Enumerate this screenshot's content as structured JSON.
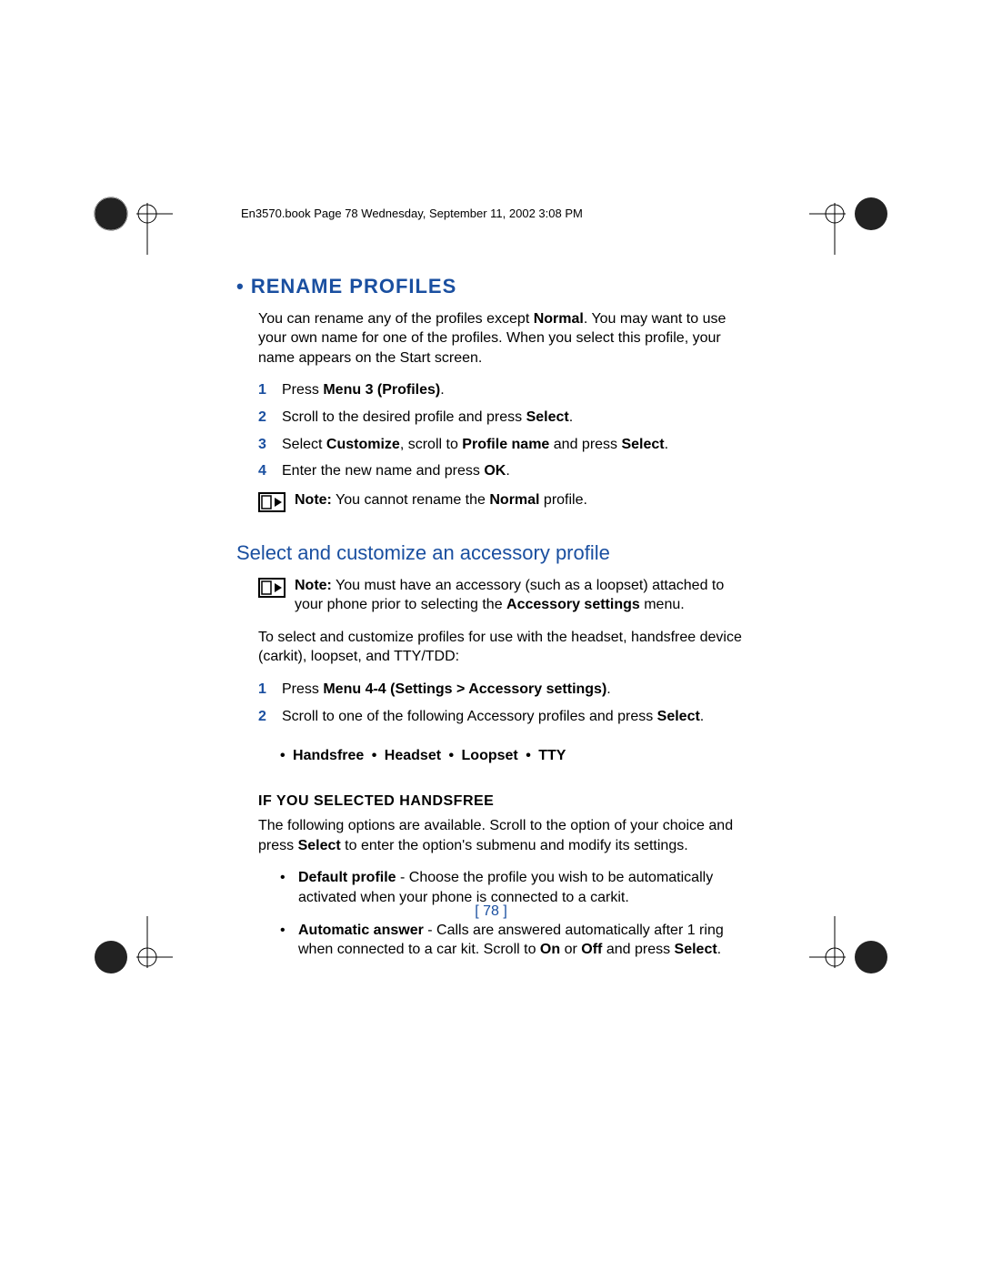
{
  "header": "En3570.book  Page 78  Wednesday, September 11, 2002  3:08 PM",
  "title": "• RENAME PROFILES",
  "intro": "You can rename any of the profiles except <b>Normal</b>. You may want to use your own name for one of the profiles. When you select this profile, your name appears on the Start screen.",
  "steps1": [
    "Press <b>Menu 3 (Profiles)</b>.",
    "Scroll to the desired profile and press <b>Select</b>.",
    "Select <b>Customize</b>, scroll to <b>Profile name</b> and press <b>Select</b>.",
    "Enter the new name and press <b>OK</b>."
  ],
  "note1": "<b>Note:</b> You cannot rename the <b>Normal</b> profile.",
  "subtitle": "Select and customize an accessory profile",
  "note2": "<b>Note:</b>  You must have an accessory (such as a loopset) attached to your phone prior to selecting the <b>Accessory settings</b> menu.",
  "para2": "To select and customize profiles for use with the headset, handsfree device (carkit), loopset, and TTY/TDD:",
  "steps2": [
    "Press <b>Menu 4-4 (Settings > Accessory settings)</b>.",
    "Scroll to one of the following Accessory profiles and press <b>Select</b>."
  ],
  "inline_bullets": "•   Handsfree   •   Headset   •   Loopset   •   TTY",
  "h3": "IF YOU SELECTED HANDSFREE",
  "para3": "The following options are available. Scroll to the option of your choice and press <b>Select</b> to enter the option's submenu and modify its settings.",
  "bullets3": [
    "<b>Default profile</b> - Choose the profile you wish to be automatically activated when your phone is connected to a carkit.",
    "<b>Automatic answer</b> - Calls are answered automatically after 1 ring when connected to a car kit. Scroll to <b>On</b> or <b>Off</b> and press <b>Select</b>."
  ],
  "page_number": "[ 78 ]"
}
